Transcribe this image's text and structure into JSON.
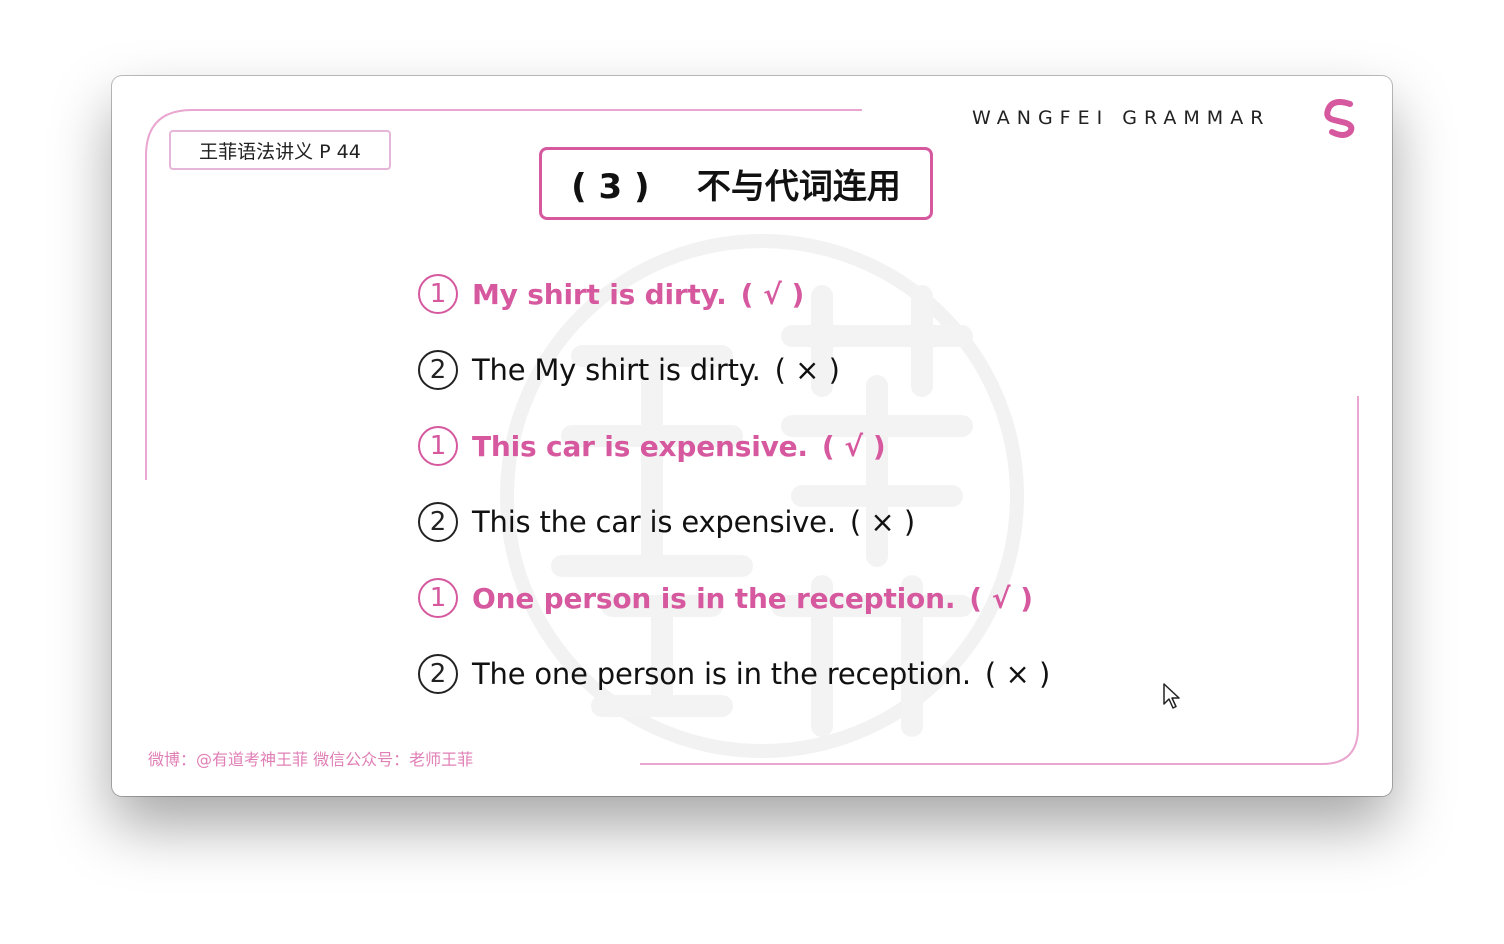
{
  "slide": {
    "page_ref": "王菲语法讲义 P 44",
    "brand": "WANGFEI  GRAMMAR",
    "brand_logo_icon": "g-logo-icon",
    "title": "( 3 )    不与代词连用",
    "footer": "微博：@有道考神王菲 微信公众号：老师王菲",
    "accent_color": "#d6589e",
    "examples": [
      {
        "num": "1",
        "text": "My shirt is dirty.",
        "mark": "( √ )",
        "correct": true
      },
      {
        "num": "2",
        "text": "The My shirt is dirty.",
        "mark": "( × )",
        "correct": false
      },
      {
        "num": "1",
        "text": "This car is expensive.",
        "mark": "( √ )",
        "correct": true
      },
      {
        "num": "2",
        "text": "This the car is expensive.",
        "mark": "( × )",
        "correct": false
      },
      {
        "num": "1",
        "text": "One person is in the reception.",
        "mark": "( √ )",
        "correct": true
      },
      {
        "num": "2",
        "text": "The one person is in the reception.",
        "mark": "( × )",
        "correct": false
      }
    ]
  }
}
